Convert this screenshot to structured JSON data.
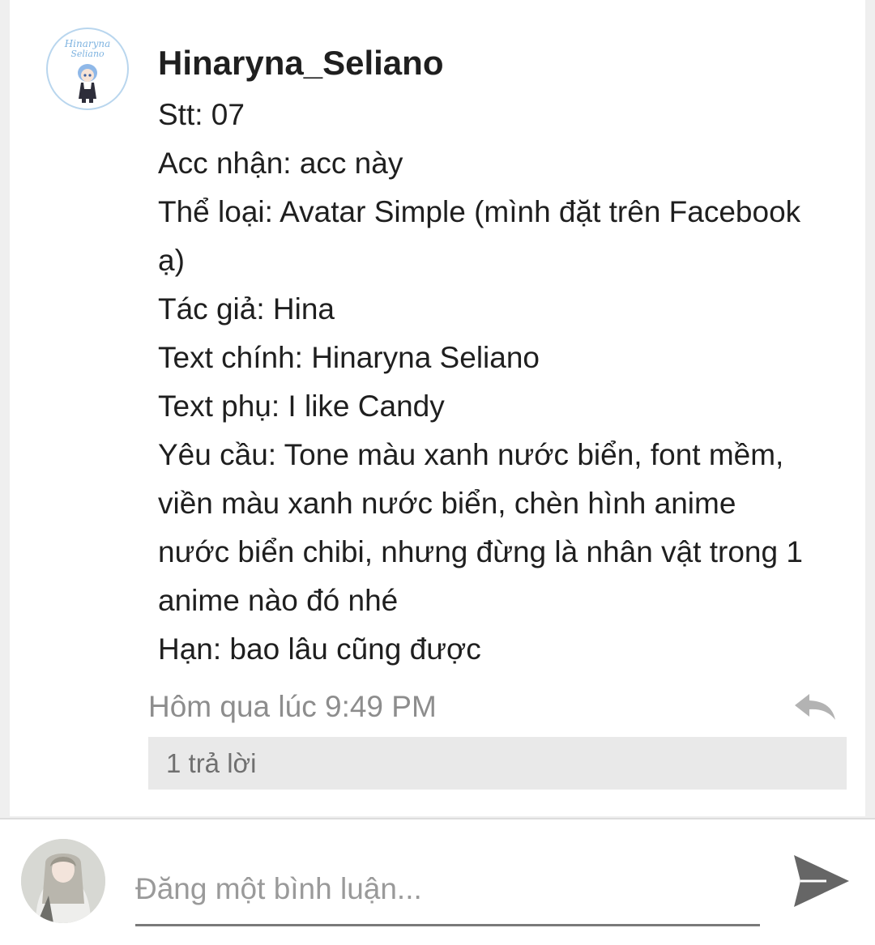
{
  "post": {
    "author": "Hinaryna_Seliano",
    "avatar_text": "Hinaryna Seliano",
    "lines": [
      "Stt: 07",
      "Acc nhận: acc này",
      "Thể loại: Avatar Simple (mình đặt trên Facebook",
      "ạ)",
      "Tác giả: Hina",
      "Text chính: Hinaryna Seliano",
      "Text phụ: I like Candy",
      "Yêu cầu: Tone màu xanh nước biển, font mềm,",
      "viền màu xanh nước biển, chèn hình anime",
      "nước biển chibi, nhưng đừng là nhân vật trong 1",
      "anime nào đó nhé",
      "Hạn: bao lâu cũng được"
    ],
    "timestamp": "Hôm qua lúc 9:49 PM",
    "replies_label": "1 trả lời",
    "reply_icon": "reply-arrow-icon"
  },
  "composer": {
    "placeholder": "Đăng một bình luận...",
    "send_icon": "send-icon"
  },
  "colors": {
    "text": "#1f1f1f",
    "muted": "#8d8d8d",
    "replies_bg": "#e9e9e9",
    "avatar_border": "#b9d6ee"
  }
}
